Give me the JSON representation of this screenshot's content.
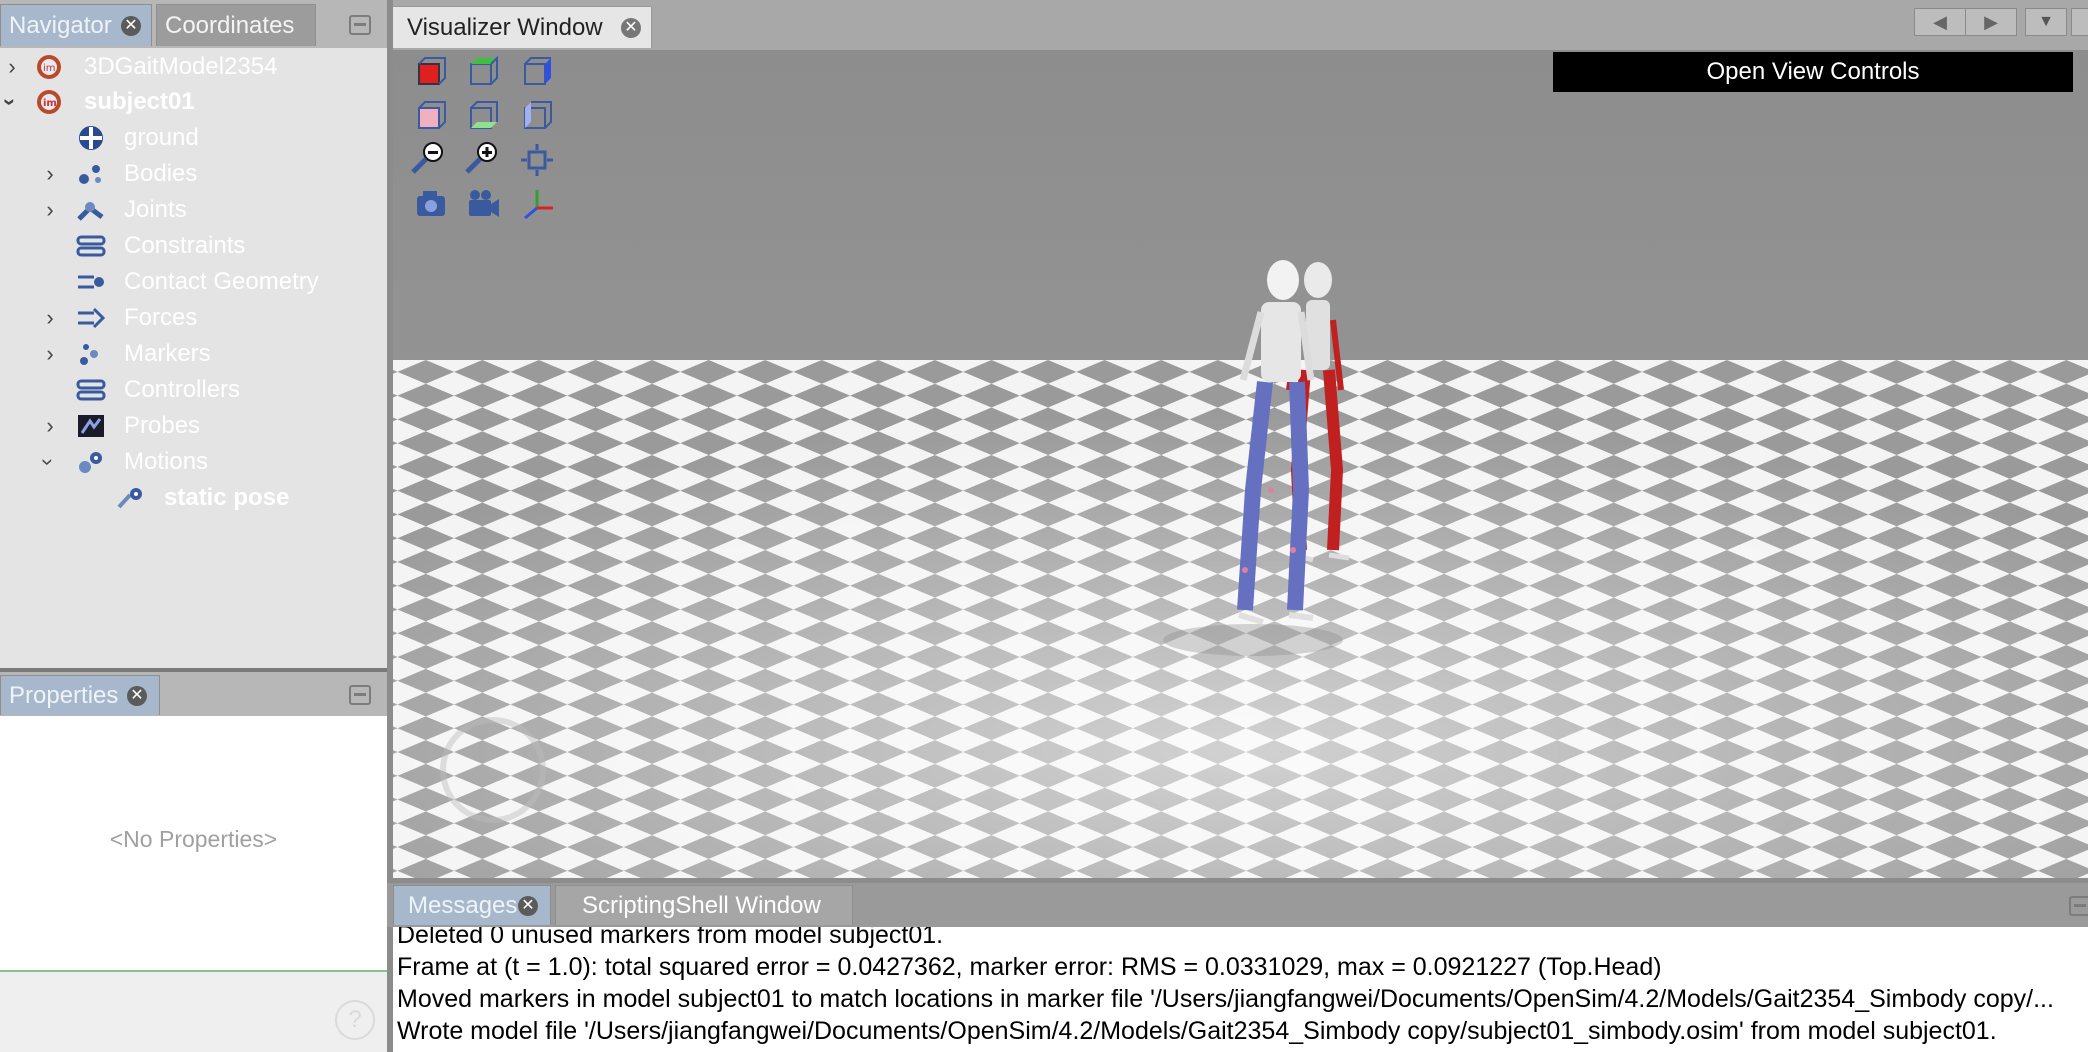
{
  "navigator": {
    "tabs": [
      "Navigator",
      "Coordinates"
    ],
    "tree": [
      {
        "label": "3DGaitModel2354",
        "expander": "collapsed",
        "icon": "model-icon"
      },
      {
        "label": "subject01",
        "expander": "expanded",
        "icon": "model-icon",
        "bold": true
      },
      {
        "label": "ground",
        "expander": "none",
        "icon": "ground-icon"
      },
      {
        "label": "Bodies",
        "expander": "collapsed",
        "icon": "bodies-icon"
      },
      {
        "label": "Joints",
        "expander": "collapsed",
        "icon": "joints-icon"
      },
      {
        "label": "Constraints",
        "expander": "none",
        "icon": "constraints-icon"
      },
      {
        "label": "Contact Geometry",
        "expander": "none",
        "icon": "contact-geometry-icon"
      },
      {
        "label": "Forces",
        "expander": "collapsed",
        "icon": "forces-icon"
      },
      {
        "label": "Markers",
        "expander": "collapsed",
        "icon": "markers-icon"
      },
      {
        "label": "Controllers",
        "expander": "none",
        "icon": "controllers-icon"
      },
      {
        "label": "Probes",
        "expander": "collapsed",
        "icon": "probes-icon"
      },
      {
        "label": "Motions",
        "expander": "expanded",
        "icon": "motions-icon"
      },
      {
        "label": "static pose",
        "expander": "none",
        "icon": "motion-icon",
        "bold": true
      }
    ]
  },
  "properties": {
    "tab": "Properties",
    "empty_text": "<No Properties>"
  },
  "visualizer": {
    "tab": "Visualizer Window",
    "open_view_controls": "Open View Controls",
    "toolbar_icons": [
      "front-view-icon",
      "top-view-icon",
      "right-view-icon",
      "back-view-icon",
      "bottom-view-icon",
      "left-view-icon",
      "zoom-out-icon",
      "zoom-in-icon",
      "fit-view-icon",
      "snapshot-icon",
      "record-movie-icon",
      "axes-toggle-icon"
    ]
  },
  "messages": {
    "tabs": [
      "Messages",
      "ScriptingShell Window"
    ],
    "lines": [
      "Deleted 0 unused markers from model subject01.",
      "Frame at (t = 1.0):        total squared error = 0.0427362, marker error: RMS = 0.0331029, max = 0.0921227 (Top.Head)",
      "Moved markers in model subject01 to match locations in marker file '/Users/jiangfangwei/Documents/OpenSim/4.2/Models/Gait2354_Simbody copy/...",
      "Wrote model file '/Users/jiangfangwei/Documents/OpenSim/4.2/Models/Gait2354_Simbody copy/subject01_simbody.osim' from model subject01."
    ]
  },
  "colors": {
    "accent_tab": "#a8b8cc",
    "left_model_muscle": "#6670c0",
    "right_model_muscle": "#c02020"
  }
}
